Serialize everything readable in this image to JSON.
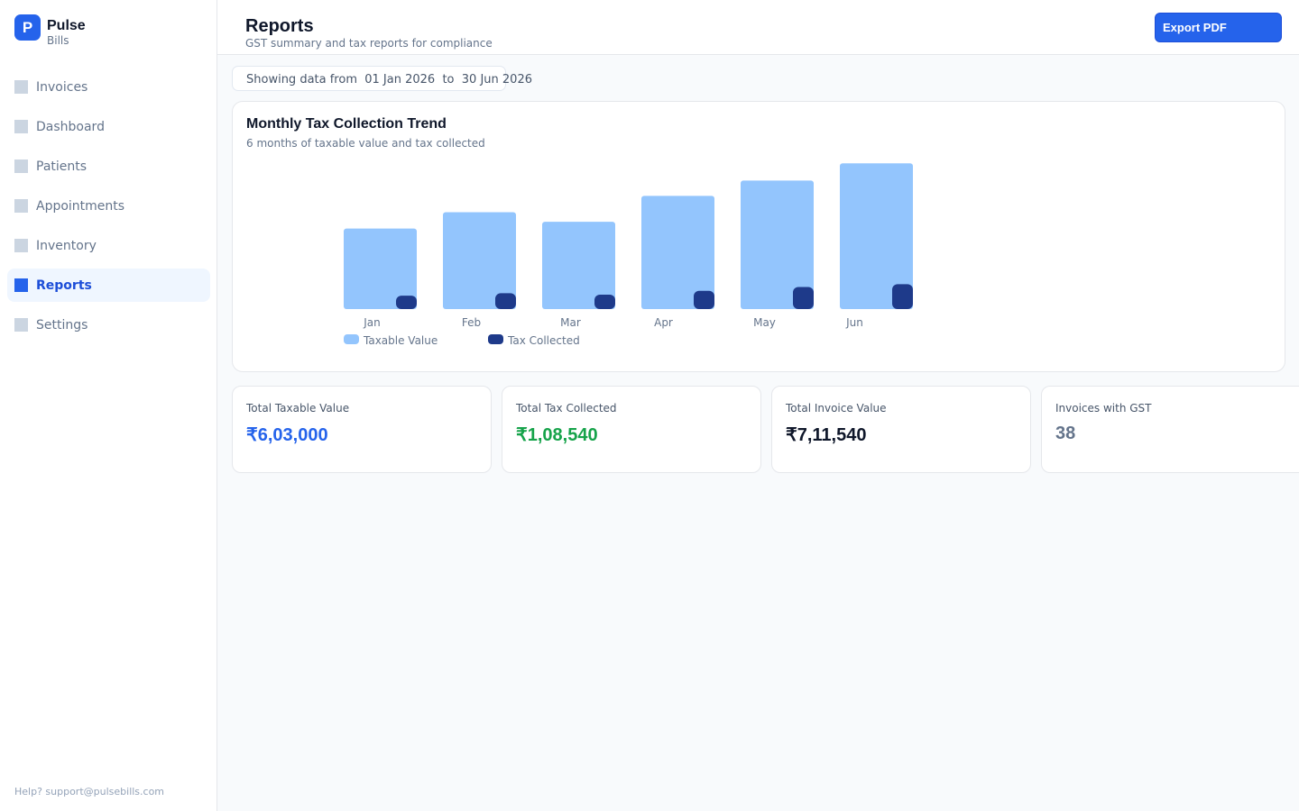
{
  "sidebar": {
    "logo_letter": "P",
    "brand_name": "Pulse",
    "brand_sub": "Bills",
    "items": [
      {
        "label": "Invoices",
        "icon": "invoices-icon"
      },
      {
        "label": "Dashboard",
        "icon": "dashboard-icon"
      },
      {
        "label": "Patients",
        "icon": "patients-icon"
      },
      {
        "label": "Appointments",
        "icon": "appointments-icon"
      },
      {
        "label": "Inventory",
        "icon": "inventory-icon"
      },
      {
        "label": "Reports",
        "icon": "reports-icon",
        "active": true
      },
      {
        "label": "Settings",
        "icon": "settings-icon"
      }
    ],
    "help": "Help? support@pulsebills.com"
  },
  "header": {
    "title": "Reports",
    "subtitle": "GST summary and tax reports for compliance",
    "export_label": "Export PDF"
  },
  "date_range": {
    "prefix": "Showing data from",
    "from": "01 Jan 2026",
    "separator": "to",
    "to": "30 Jun 2026"
  },
  "chart": {
    "title": "Monthly Tax Collection Trend",
    "subtitle": "6 months of taxable value and tax collected"
  },
  "chart_data": {
    "type": "bar",
    "title": "Monthly Tax Collection Trend",
    "categories": [
      "Jan",
      "Feb",
      "Mar",
      "Apr",
      "May",
      "Jun"
    ],
    "series": [
      {
        "name": "Taxable Value",
        "color": "#93c5fd",
        "values": [
          84000,
          101000,
          91000,
          118000,
          134000,
          152000
        ]
      },
      {
        "name": "Tax Collected",
        "color": "#1e3a8a",
        "values": [
          14000,
          16500,
          15000,
          19000,
          23000,
          26000
        ]
      }
    ],
    "legend_position": "bottom-left",
    "grid": false
  },
  "stats": [
    {
      "label": "Total Taxable Value",
      "value": "₹6,03,000",
      "color": "#2563eb"
    },
    {
      "label": "Total Tax Collected",
      "value": "₹1,08,540",
      "color": "#16a34a"
    },
    {
      "label": "Total Invoice Value",
      "value": "₹7,11,540",
      "color": "#0f172a"
    },
    {
      "label": "Invoices with GST",
      "value": "38",
      "color": "#64748b"
    }
  ]
}
